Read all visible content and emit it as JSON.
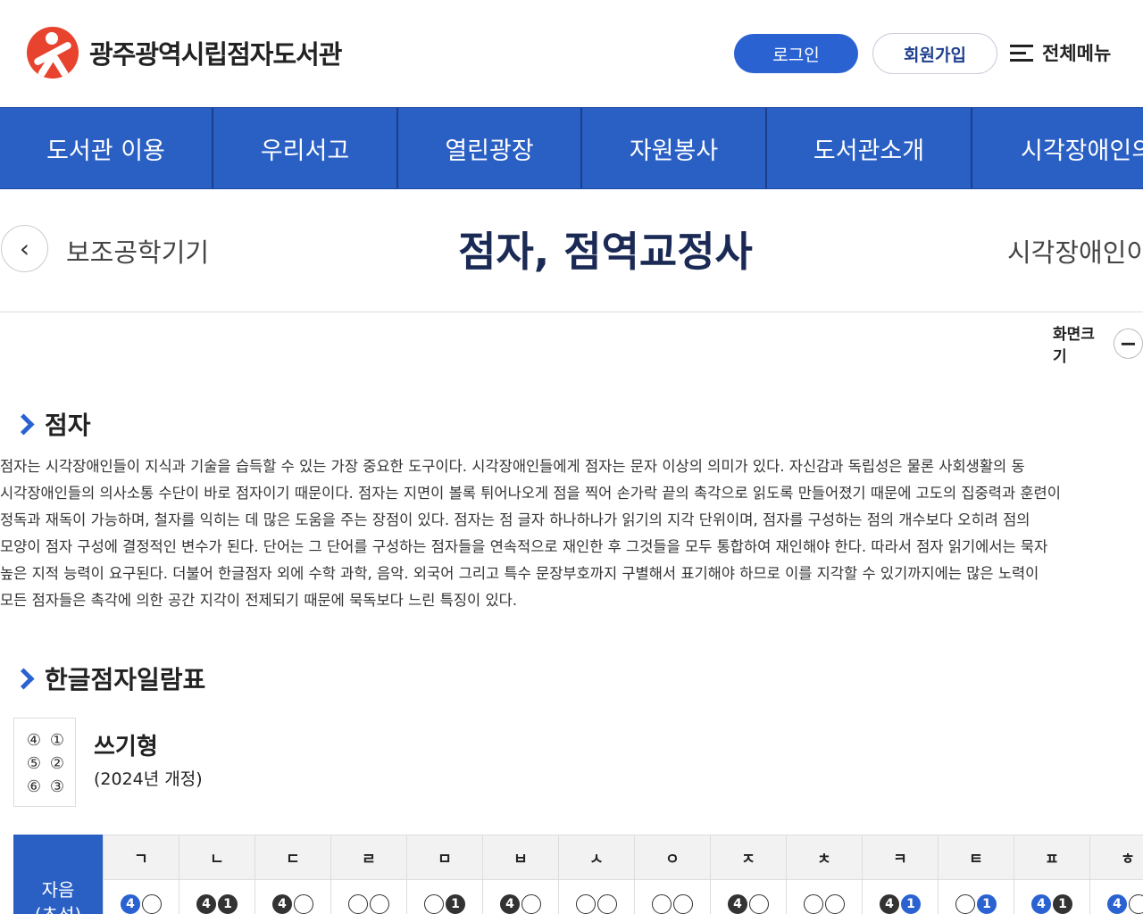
{
  "header": {
    "site_name": "광주광역시립점자도서관",
    "login_label": "로그인",
    "join_label": "회원가입",
    "menu_label": "전체메뉴"
  },
  "gnb": [
    {
      "label": "도서관 이용"
    },
    {
      "label": "우리서고"
    },
    {
      "label": "열린광장"
    },
    {
      "label": "자원봉사"
    },
    {
      "label": "도서관소개"
    },
    {
      "label": "시각장애인의"
    }
  ],
  "subnav": {
    "prev": "보조공학기기",
    "title": "점자, 점역교정사",
    "next": "시각장애인이"
  },
  "zoom": {
    "label": "화면크기",
    "minus": "−"
  },
  "section1": {
    "heading": "점자",
    "lines": [
      "점자는 시각장애인들이 지식과 기술을 습득할 수 있는 가장 중요한 도구이다. 시각장애인들에게 점자는 문자 이상의 의미가 있다. 자신감과 독립성은 물론 사회생활의 동",
      "시각장애인들의 의사소통 수단이 바로 점자이기 때문이다. 점자는 지면이 볼록 튀어나오게 점을 찍어 손가락 끝의 촉각으로 읽도록 만들어졌기 때문에 고도의 집중력과 훈련이",
      "정독과 재독이 가능하며, 철자를 익히는 데 많은 도움을 주는 장점이 있다. 점자는 점 글자 하나하나가 읽기의 지각 단위이며, 점자를 구성하는 점의 개수보다 오히려 점의",
      "모양이 점자 구성에 결정적인 변수가 된다. 단어는 그 단어를 구성하는 점자들을 연속적으로 재인한 후 그것들을 모두 통합하여 재인해야 한다. 따라서 점자 읽기에서는 묵자",
      "높은 지적 능력이 요구된다. 더불어 한글점자 외에 수학 과학, 음악. 외국어 그리고 특수 문장부호까지 구별해서 표기해야 하므로 이를 지각할 수 있기까지에는 많은 노력이",
      "모든 점자들은 촉각에 의한 공간 지각이 전제되기 때문에 묵독보다 느린 특징이 있다."
    ]
  },
  "section2": {
    "heading": "한글점자일람표",
    "cell_numbers": [
      "④",
      "①",
      "⑤",
      "②",
      "⑥",
      "③"
    ],
    "type_title": "쓰기형",
    "type_sub": "(2024년 개정)",
    "row_head": "자음\n(초성)",
    "columns": [
      {
        "label": "ㄱ",
        "dots": [
          {
            "t": "4",
            "s": "blue"
          },
          {
            "t": "",
            "s": "empty"
          }
        ]
      },
      {
        "label": "ㄴ",
        "dots": [
          {
            "t": "4",
            "s": "filled"
          },
          {
            "t": "1",
            "s": "filled"
          }
        ]
      },
      {
        "label": "ㄷ",
        "dots": [
          {
            "t": "4",
            "s": "filled"
          },
          {
            "t": "",
            "s": "empty"
          }
        ]
      },
      {
        "label": "ㄹ",
        "dots": [
          {
            "t": "",
            "s": "empty"
          },
          {
            "t": "",
            "s": "empty"
          }
        ]
      },
      {
        "label": "ㅁ",
        "dots": [
          {
            "t": "",
            "s": "empty"
          },
          {
            "t": "1",
            "s": "filled"
          }
        ]
      },
      {
        "label": "ㅂ",
        "dots": [
          {
            "t": "4",
            "s": "filled"
          },
          {
            "t": "",
            "s": "empty"
          }
        ]
      },
      {
        "label": "ㅅ",
        "dots": [
          {
            "t": "",
            "s": "empty"
          },
          {
            "t": "",
            "s": "empty"
          }
        ]
      },
      {
        "label": "ㅇ",
        "dots": [
          {
            "t": "",
            "s": "empty"
          },
          {
            "t": "",
            "s": "empty"
          }
        ]
      },
      {
        "label": "ㅈ",
        "dots": [
          {
            "t": "4",
            "s": "filled"
          },
          {
            "t": "",
            "s": "empty"
          }
        ]
      },
      {
        "label": "ㅊ",
        "dots": [
          {
            "t": "",
            "s": "empty"
          },
          {
            "t": "",
            "s": "empty"
          }
        ]
      },
      {
        "label": "ㅋ",
        "dots": [
          {
            "t": "4",
            "s": "filled"
          },
          {
            "t": "1",
            "s": "blue"
          }
        ]
      },
      {
        "label": "ㅌ",
        "dots": [
          {
            "t": "",
            "s": "empty"
          },
          {
            "t": "1",
            "s": "blue"
          }
        ]
      },
      {
        "label": "ㅍ",
        "dots": [
          {
            "t": "4",
            "s": "blue"
          },
          {
            "t": "1",
            "s": "filled"
          }
        ]
      },
      {
        "label": "ㅎ",
        "dots": [
          {
            "t": "4",
            "s": "blue"
          },
          {
            "t": "",
            "s": "empty"
          }
        ]
      }
    ]
  },
  "colors": {
    "primary": "#2a5fc4",
    "accent": "#2a62d1",
    "logo": "#e8432e",
    "title": "#1b2a55"
  }
}
